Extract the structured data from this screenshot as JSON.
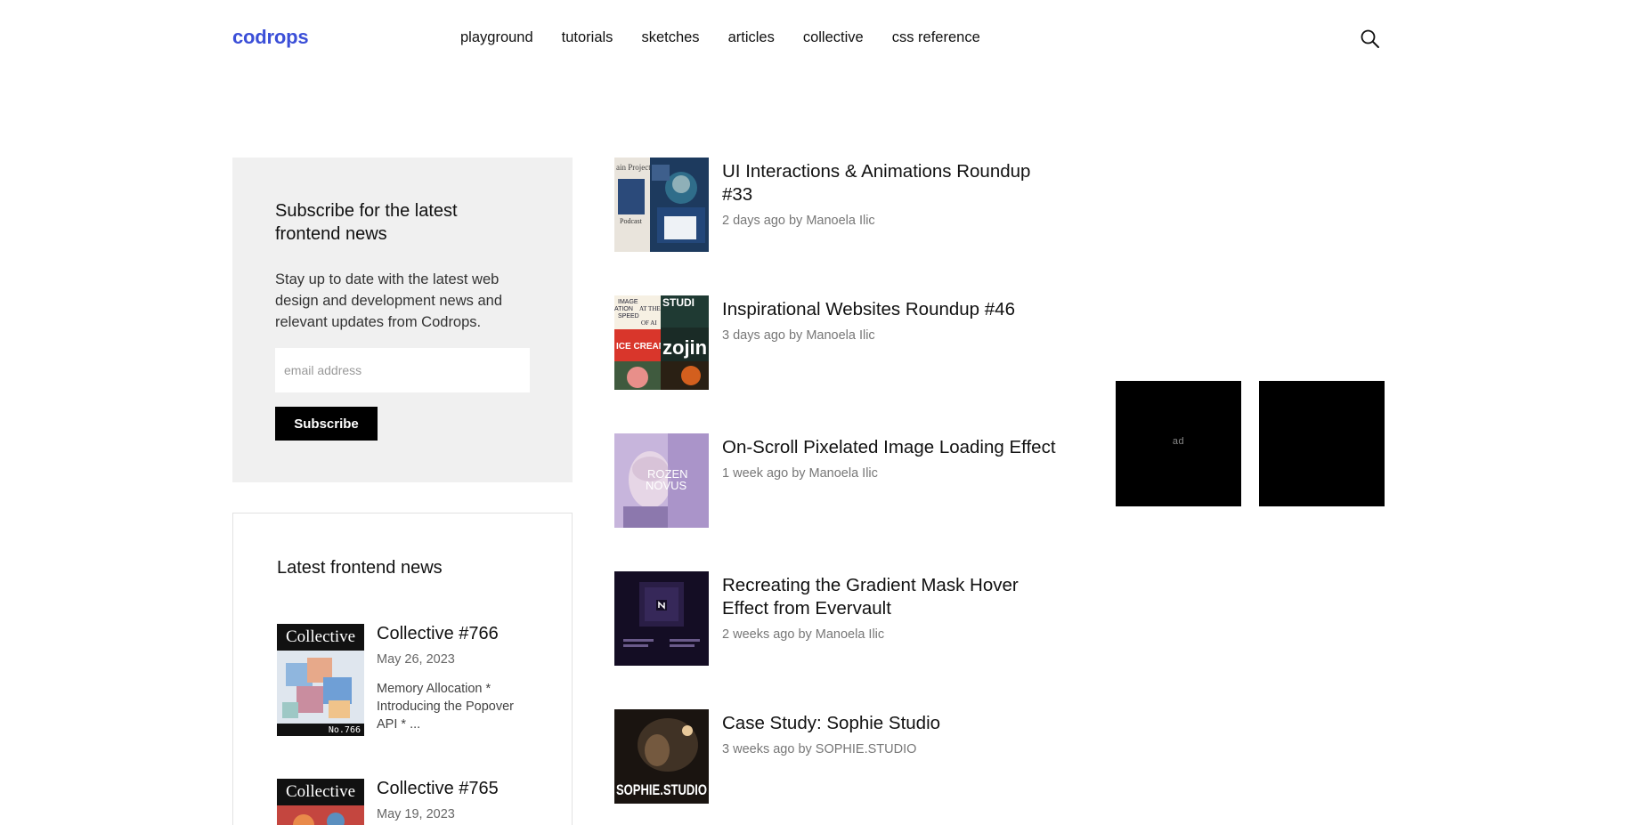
{
  "header": {
    "logo": "codrops",
    "nav": [
      "playground",
      "tutorials",
      "sketches",
      "articles",
      "collective",
      "css reference"
    ],
    "search_icon": "search-icon"
  },
  "subscribe": {
    "title": "Subscribe for the latest frontend news",
    "description": "Stay up to date with the latest web design and development news and relevant updates from Codrops.",
    "email_placeholder": "email address",
    "button_label": "Subscribe"
  },
  "latest_news": {
    "heading": "Latest frontend news",
    "items": [
      {
        "thumb_title": "Collective",
        "thumb_number": "No.766",
        "title": "Collective #766",
        "date": "May 26, 2023",
        "excerpt": "Memory Allocation * Introducing the Popover API * ..."
      },
      {
        "thumb_title": "Collective",
        "title": "Collective #765",
        "date": "May 19, 2023"
      }
    ]
  },
  "articles": [
    {
      "title": "UI Interactions & Animations Roundup #33",
      "meta": "2 days ago by Manoela Ilic"
    },
    {
      "title": "Inspirational Websites Roundup #46",
      "meta": "3 days ago by Manoela Ilic"
    },
    {
      "title": "On-Scroll Pixelated Image Loading Effect",
      "meta": "1 week ago by Manoela Ilic"
    },
    {
      "title": "Recreating the Gradient Mask Hover Effect from Evervault",
      "meta": "2 weeks ago by Manoela Ilic"
    },
    {
      "title": "Case Study: Sophie Studio",
      "meta": "3 weeks ago by SOPHIE.STUDIO"
    }
  ],
  "ads": {
    "label": "ad"
  },
  "thumbnails": {
    "article_1": {
      "text_1": "ain Project",
      "text_2": "Podcast"
    },
    "article_2": {
      "text_1": "IMAGE",
      "text_2": "ATION",
      "text_3": "AT THE",
      "text_4": "SPEED",
      "text_5": "OF AI",
      "text_6": "ICE CREAM",
      "text_7": "zojin",
      "text_8": "STUDI"
    },
    "article_3": {
      "text_1": "ROZEN",
      "text_2": "NOVUS"
    },
    "article_5": {
      "text_1": "SOPHIE.STUDIO"
    }
  }
}
